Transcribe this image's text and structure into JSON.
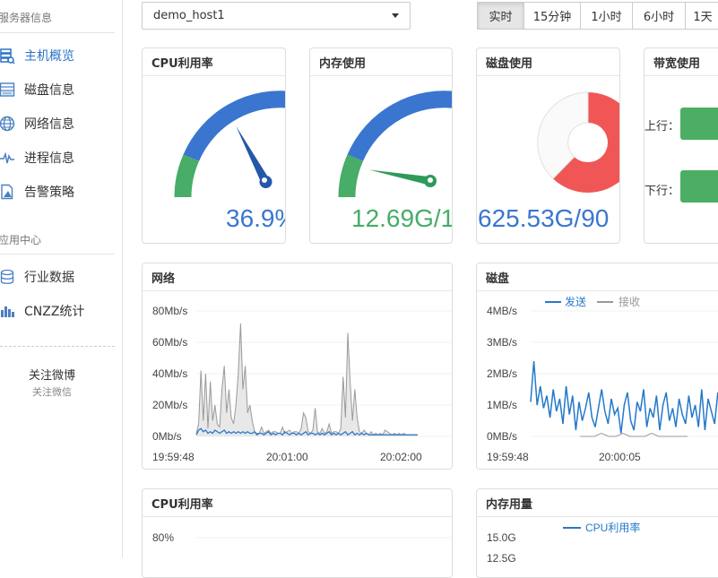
{
  "sidebar": {
    "server_section": "服务器信息",
    "items": [
      {
        "label": "主机概览",
        "icon": "server-icon"
      },
      {
        "label": "磁盘信息",
        "icon": "disk-icon"
      },
      {
        "label": "网络信息",
        "icon": "globe-icon"
      },
      {
        "label": "进程信息",
        "icon": "pulse-icon"
      },
      {
        "label": "告警策略",
        "icon": "alert-doc-icon"
      }
    ],
    "app_section": "应用中心",
    "app_items": [
      {
        "label": "行业数据",
        "icon": "database-icon"
      },
      {
        "label": "CNZZ统计",
        "icon": "bar-chart-icon"
      }
    ],
    "follow_title": "关注微博",
    "follow_sub": "关注微信"
  },
  "toolbar": {
    "host_value": "demo_host1",
    "time_ranges": [
      "实时",
      "15分钟",
      "1小时",
      "6小时",
      "1天"
    ],
    "active_range": "实时"
  },
  "gauges": {
    "cpu": {
      "title": "CPU利用率",
      "value": "36.9%",
      "percent": 36.9
    },
    "mem": {
      "title": "内存使用",
      "value": "12.69G/1",
      "percent": 20
    },
    "disk": {
      "title": "磁盘使用",
      "value": "625.53G/90"
    },
    "bandwidth": {
      "title": "带宽使用",
      "up_label": "上行：",
      "down_label": "下行："
    }
  },
  "colors": {
    "blue": "#3a76cf",
    "green": "#47ad67",
    "red": "#f05656",
    "gray": "#999999",
    "line_blue": "#2579c9"
  },
  "chart_data": [
    {
      "type": "area",
      "title": "网络",
      "y_ticks": [
        "80Mb/s",
        "60Mb/s",
        "40Mb/s",
        "20Mb/s",
        "0Mb/s"
      ],
      "ylim": [
        0,
        80
      ],
      "x_ticks": [
        "19:59:48",
        "20:01:00",
        "20:02:00"
      ],
      "series": [
        {
          "name": "",
          "color": "#999999",
          "values": [
            2,
            8,
            42,
            10,
            40,
            5,
            35,
            10,
            20,
            8,
            6,
            30,
            45,
            15,
            30,
            12,
            8,
            20,
            40,
            72,
            30,
            45,
            15,
            20,
            10,
            3,
            2,
            2,
            6,
            2,
            3,
            4,
            2,
            3,
            3,
            2,
            2,
            6,
            2,
            3,
            4,
            2,
            3,
            3,
            2,
            5,
            15,
            12,
            3,
            2,
            4,
            18,
            3,
            2,
            5,
            2,
            3,
            8,
            2,
            3,
            3,
            2,
            5,
            38,
            12,
            66,
            35,
            10,
            30,
            12,
            3,
            2,
            4,
            2,
            1,
            3,
            1,
            2,
            1,
            2,
            1,
            4,
            3,
            2,
            1,
            2,
            1,
            2,
            1,
            2,
            1,
            1,
            1,
            1,
            1,
            1
          ]
        },
        {
          "name": "",
          "color": "#2579c9",
          "values": [
            1,
            4,
            5,
            3,
            4,
            2,
            3,
            2,
            4,
            3,
            2,
            3,
            4,
            2,
            3,
            2,
            3,
            2,
            3,
            2,
            3,
            2,
            3,
            2,
            2,
            3,
            1,
            2,
            2,
            1,
            2,
            3,
            1,
            2,
            1,
            2,
            2,
            1,
            3,
            2,
            1,
            2,
            2,
            1,
            2,
            1,
            2,
            3,
            1,
            2,
            2,
            1,
            2,
            1,
            2,
            1,
            2,
            3,
            1,
            2,
            1,
            2,
            1,
            2,
            3,
            1,
            2,
            3,
            1,
            2,
            1,
            2,
            1,
            2,
            1,
            1,
            1,
            1,
            1,
            1,
            1,
            1,
            1,
            1,
            1,
            1,
            1,
            1,
            1,
            1,
            1,
            1,
            1,
            1,
            1,
            1
          ]
        }
      ]
    },
    {
      "type": "line",
      "title": "磁盘",
      "legend": [
        "发送",
        "接收"
      ],
      "y_ticks": [
        "4MB/s",
        "3MB/s",
        "2MB/s",
        "1MB/s",
        "0MB/s"
      ],
      "ylim": [
        0,
        4
      ],
      "x_ticks": [
        "19:59:48",
        "20:00:05"
      ],
      "series": [
        {
          "name": "发送",
          "color": "#2579c9",
          "values": [
            1.1,
            2.4,
            1.0,
            1.6,
            0.9,
            1.3,
            0.6,
            1.5,
            0.8,
            1.2,
            0.4,
            1.6,
            0.7,
            1.3,
            0.2,
            1.1,
            0.5,
            0.9,
            1.4,
            0.6,
            0.3,
            0.9,
            1.5,
            0.8,
            0.4,
            1.2,
            0.7,
            0.9,
            0.1,
            1.0,
            1.4,
            0.5,
            0.2,
            1.1,
            0.8,
            1.5,
            0.3,
            0.9,
            0.6,
            1.3,
            0.2,
            1.0,
            1.4,
            0.5,
            0.9,
            0.3,
            1.2,
            0.7,
            0.4,
            1.3,
            0.6,
            1.0,
            0.3,
            1.5,
            0.2,
            1.2,
            0.8,
            0.4,
            1.4,
            1.0,
            0.6
          ]
        },
        {
          "name": "接收",
          "color": "#999999",
          "values": [
            0.0,
            0.0,
            0.0,
            0.1,
            0.0,
            0.0,
            0.1,
            0.0,
            0.0,
            0.0,
            0.1,
            0.0,
            0.0,
            0.0,
            0.0,
            0.0
          ]
        }
      ]
    },
    {
      "type": "line",
      "title": "CPU利用率",
      "y_ticks": [
        "80%"
      ],
      "ylim": [
        0,
        100
      ]
    },
    {
      "type": "line",
      "title": "内存用量",
      "legend": [
        "CPU利用率"
      ],
      "y_ticks": [
        "15.0G",
        "12.5G"
      ]
    }
  ]
}
